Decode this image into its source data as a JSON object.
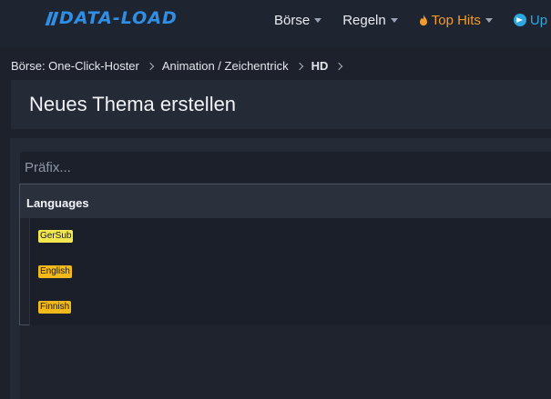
{
  "header": {
    "logo_text": "DATA-LOAD",
    "nav": [
      {
        "label": "Börse",
        "has_caret": true
      },
      {
        "label": "Regeln",
        "has_caret": true
      },
      {
        "label": "Top Hits",
        "has_caret": true,
        "icon": "flame-icon",
        "color": "#f39c2a"
      },
      {
        "label": "Up",
        "icon": "telegram-icon",
        "color": "#2ea6e0"
      }
    ]
  },
  "breadcrumb": [
    "Börse: One-Click-Hoster",
    "Animation / Zeichentrick",
    "HD"
  ],
  "page": {
    "title": "Neues Thema erstellen"
  },
  "form": {
    "prefix_placeholder": "Präfix..."
  },
  "dropdown": {
    "group_label": "Languages",
    "options": [
      {
        "label": "GerSub",
        "color": "#f2e651"
      },
      {
        "label": "English",
        "color": "#f2b91a"
      },
      {
        "label": "Finnish",
        "color": "#f2b91a"
      }
    ]
  },
  "colors": {
    "brand": "#2f8fe6",
    "background": "#1d212c",
    "panel": "#252a37"
  }
}
